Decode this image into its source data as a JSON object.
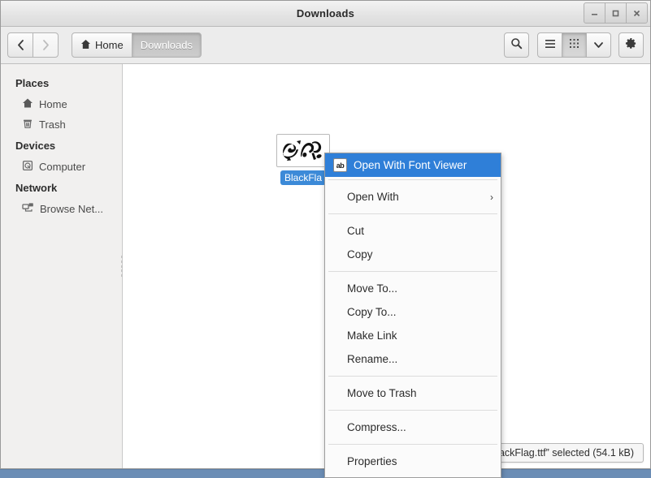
{
  "window": {
    "title": "Downloads",
    "buttons": [
      {
        "name": "minimize",
        "glyph": "–"
      },
      {
        "name": "maximize",
        "glyph": "□"
      },
      {
        "name": "close",
        "glyph": "✕"
      }
    ]
  },
  "toolbar": {
    "back_label": "‹",
    "forward_label": "›",
    "breadcrumb": [
      {
        "label": "Home",
        "icon": "home-icon",
        "current": false
      },
      {
        "label": "Downloads",
        "icon": "",
        "current": true
      }
    ],
    "search_label": "search-icon",
    "list_view_label": "list-view-icon",
    "grid_view_label": "grid-view-icon",
    "view_dropdown_label": "⌄",
    "settings_label": "gear-icon"
  },
  "sidebar": {
    "sections": [
      {
        "heading": "Places",
        "items": [
          {
            "label": "Home",
            "icon": "home-icon"
          },
          {
            "label": "Trash",
            "icon": "trash-icon"
          }
        ]
      },
      {
        "heading": "Devices",
        "items": [
          {
            "label": "Computer",
            "icon": "computer-icon"
          }
        ]
      },
      {
        "heading": "Network",
        "items": [
          {
            "label": "Browse Net...",
            "icon": "network-icon"
          }
        ]
      }
    ]
  },
  "main": {
    "file": {
      "name": "BlackFla",
      "full_name": "BlackFlag.ttf",
      "icon": "font-file-thumbnail",
      "selected": true
    }
  },
  "context_menu": {
    "header": {
      "label": "Open With Font Viewer",
      "icon": "ab-font-icon"
    },
    "groups": [
      [
        {
          "label": "Open With",
          "submenu": true,
          "arrow": "›"
        }
      ],
      [
        {
          "label": "Cut"
        },
        {
          "label": "Copy"
        }
      ],
      [
        {
          "label": "Move To..."
        },
        {
          "label": "Copy To..."
        },
        {
          "label": "Make Link"
        },
        {
          "label": "Rename..."
        }
      ],
      [
        {
          "label": "Move to Trash"
        }
      ],
      [
        {
          "label": "Compress..."
        }
      ],
      [
        {
          "label": "Properties"
        }
      ]
    ]
  },
  "statusbar": {
    "text": "“BlackFlag.ttf” selected (54.1 kB)"
  },
  "colors": {
    "selection_blue": "#3c8ad8",
    "menu_highlight": "#2f7fd8",
    "toolbar_bg": "#ececec",
    "sidebar_bg": "#f1f0ef",
    "desktop": "#6b8db5"
  }
}
